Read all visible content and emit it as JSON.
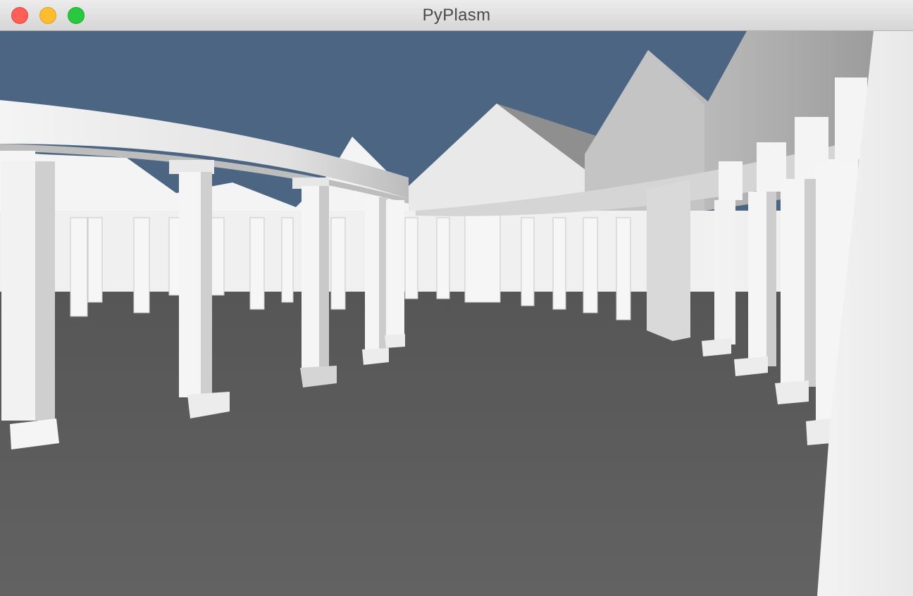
{
  "window": {
    "title": "PyPlasm",
    "controls": {
      "close": "close",
      "minimize": "minimize",
      "zoom": "zoom"
    }
  },
  "viewport": {
    "sky_color": "#4b6582",
    "ground_color": "#5e5e5e",
    "geometry_color": "#f2f2f2"
  }
}
